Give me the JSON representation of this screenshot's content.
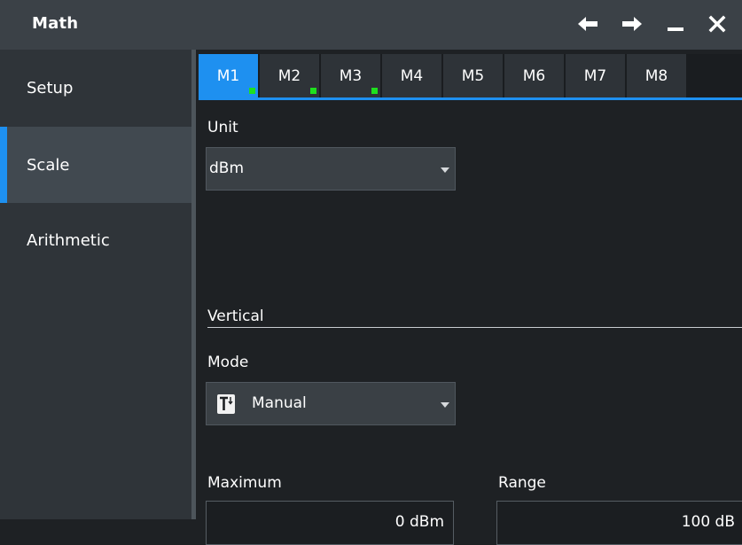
{
  "window": {
    "title": "Math",
    "buttons": [
      "back-arrow-icon",
      "forward-arrow-icon",
      "minimize-icon",
      "close-icon"
    ]
  },
  "sidebar": {
    "items": [
      {
        "label": "Setup",
        "active": false
      },
      {
        "label": "Scale",
        "active": true
      },
      {
        "label": "Arithmetic",
        "active": false
      }
    ]
  },
  "tabs": [
    {
      "label": "M1",
      "active": true,
      "indicator": true
    },
    {
      "label": "M2",
      "active": false,
      "indicator": true
    },
    {
      "label": "M3",
      "active": false,
      "indicator": true
    },
    {
      "label": "M4",
      "active": false,
      "indicator": false
    },
    {
      "label": "M5",
      "active": false,
      "indicator": false
    },
    {
      "label": "M6",
      "active": false,
      "indicator": false
    },
    {
      "label": "M7",
      "active": false,
      "indicator": false
    },
    {
      "label": "M8",
      "active": false,
      "indicator": false
    }
  ],
  "unit": {
    "label": "Unit",
    "value": "dBm"
  },
  "vertical": {
    "section_label": "Vertical",
    "mode_label": "Mode",
    "mode_value": "Manual",
    "maximum_label": "Maximum",
    "maximum_value": "0 dBm",
    "range_label": "Range",
    "range_value": "100 dB"
  },
  "colors": {
    "accent": "#1e90f0",
    "indicator": "#1ee01e",
    "titlebar": "#3b4147",
    "sidebar": "#2f3439",
    "panel": "#1e2124"
  }
}
